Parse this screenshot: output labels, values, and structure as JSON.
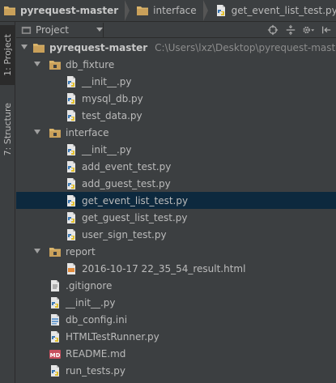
{
  "breadcrumb": {
    "items": [
      {
        "label": "pyrequest-master",
        "icon": "folder-icon"
      },
      {
        "label": "interface",
        "icon": "folder-icon"
      },
      {
        "label": "get_event_list_test.py",
        "icon": "python-file-icon"
      }
    ]
  },
  "toolstrip": {
    "project_tab": "1: Project",
    "structure_tab": "7: Structure"
  },
  "project_toolbar": {
    "view_label": "Project",
    "buttons": [
      "locate-icon",
      "collapse-all-icon",
      "settings-icon",
      "hide-icon"
    ]
  },
  "tree": {
    "root": {
      "label": "pyrequest-master",
      "path": "C:\\Users\\lxz\\Desktop\\pyrequest-master"
    },
    "db_fixture": {
      "label": "db_fixture",
      "files": [
        "__init__.py",
        "mysql_db.py",
        "test_data.py"
      ]
    },
    "interface": {
      "label": "interface",
      "files": [
        "__init__.py",
        "add_event_test.py",
        "add_guest_test.py",
        "get_event_list_test.py",
        "get_guest_list_test.py",
        "user_sign_test.py"
      ]
    },
    "report": {
      "label": "report",
      "files": [
        "2016-10-17 22_35_54_result.html"
      ]
    },
    "root_files": [
      ".gitignore",
      "__init__.py",
      "db_config.ini",
      "HTMLTestRunner.py",
      "README.md",
      "run_tests.py"
    ]
  },
  "colors": {
    "panel_bg": "#3c3f41",
    "selection_bg": "#0d293e",
    "text": "#bbbbbb",
    "path_text": "#8c8c8c"
  }
}
